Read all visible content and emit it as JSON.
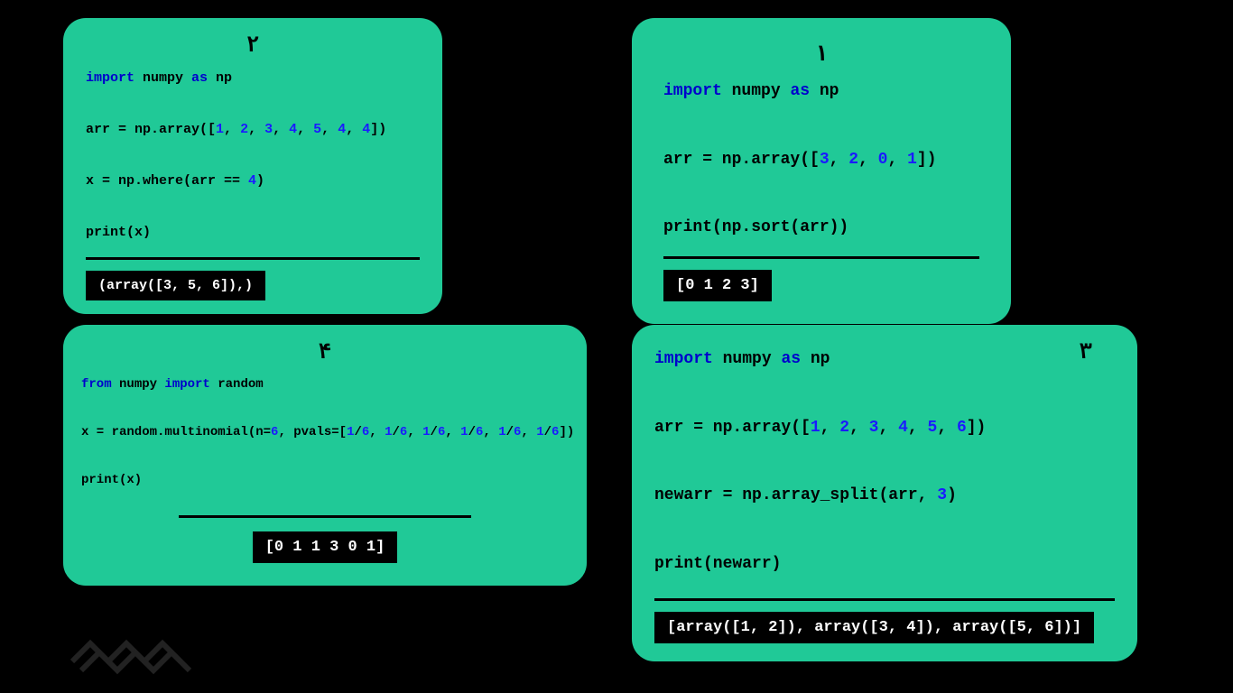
{
  "cards": {
    "c1": {
      "num": "۱",
      "l1a": "import",
      "l1b": " numpy ",
      "l1c": "as",
      "l1d": " np",
      "l2a": "arr = np.array([",
      "l2b": "3",
      "l2c": ", ",
      "l2d": "2",
      "l2e": ", ",
      "l2f": "0",
      "l2g": ", ",
      "l2h": "1",
      "l2i": "])",
      "l3": "print(np.sort(arr))",
      "out": "[0 1 2 3]"
    },
    "c2": {
      "num": "۲",
      "l1a": "import",
      "l1b": " numpy ",
      "l1c": "as",
      "l1d": " np",
      "l2a": "arr = np.array([",
      "l2b": "1",
      "l2c": ", ",
      "l2d": "2",
      "l2e": ", ",
      "l2f": "3",
      "l2g": ", ",
      "l2h": "4",
      "l2i": ", ",
      "l2j": "5",
      "l2k": ", ",
      "l2l": "4",
      "l2m": ", ",
      "l2n": "4",
      "l2o": "])",
      "l3a": "x = np.where(arr == ",
      "l3b": "4",
      "l3c": ")",
      "l4": "print(x)",
      "out": "(array([3, 5, 6]),)"
    },
    "c3": {
      "num": "۳",
      "l1a": "import",
      "l1b": " numpy ",
      "l1c": "as",
      "l1d": " np",
      "l2a": "arr = np.array([",
      "l2b": "1",
      "l2c": ", ",
      "l2d": "2",
      "l2e": ", ",
      "l2f": "3",
      "l2g": ", ",
      "l2h": "4",
      "l2i": ", ",
      "l2j": "5",
      "l2k": ", ",
      "l2l": "6",
      "l2m": "])",
      "l3a": "newarr = np.array_split(arr, ",
      "l3b": "3",
      "l3c": ")",
      "l4": "print(newarr)",
      "out": "[array([1, 2]), array([3, 4]), array([5, 6])]"
    },
    "c4": {
      "num": "۴",
      "l1a": "from",
      "l1b": " numpy ",
      "l1c": "import",
      "l1d": " random",
      "l2a": "x = random.multinomial(n=",
      "l2b": "6",
      "l2c": ", pvals=[",
      "l2d": "1",
      "l2e": "/",
      "l2f": "6",
      "l2g": ", ",
      "l2h": "1",
      "l2i": "/",
      "l2j": "6",
      "l2k": ", ",
      "l2l": "1",
      "l2m": "/",
      "l2n": "6",
      "l2o": ", ",
      "l2p": "1",
      "l2q": "/",
      "l2r": "6",
      "l2s": ", ",
      "l2t": "1",
      "l2u": "/",
      "l2v": "6",
      "l2w": ", ",
      "l2x": "1",
      "l2y": "/",
      "l2z": "6",
      "l2aa": "])",
      "l3": "print(x)",
      "out": "[0 1 1 3 0 1]"
    }
  }
}
